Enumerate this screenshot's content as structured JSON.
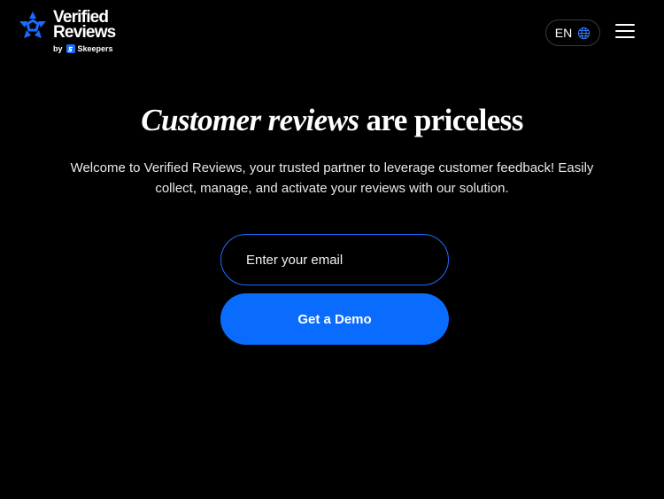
{
  "brand": {
    "name_line1": "Verified",
    "name_line2": "Reviews",
    "by": "by",
    "parent": "Skeepers",
    "accent_color": "#0a6cff"
  },
  "header": {
    "language": "EN",
    "language_icon": "globe-icon",
    "menu_icon": "hamburger-menu-icon"
  },
  "hero": {
    "title_italic": "Customer reviews",
    "title_rest": "are priceless",
    "subtitle": "Welcome to Verified Reviews, your trusted partner to leverage customer feedback! Easily collect, manage, and activate your reviews with our solution."
  },
  "form": {
    "email_placeholder": "Enter your email",
    "email_value": "",
    "submit_label": "Get a Demo"
  }
}
